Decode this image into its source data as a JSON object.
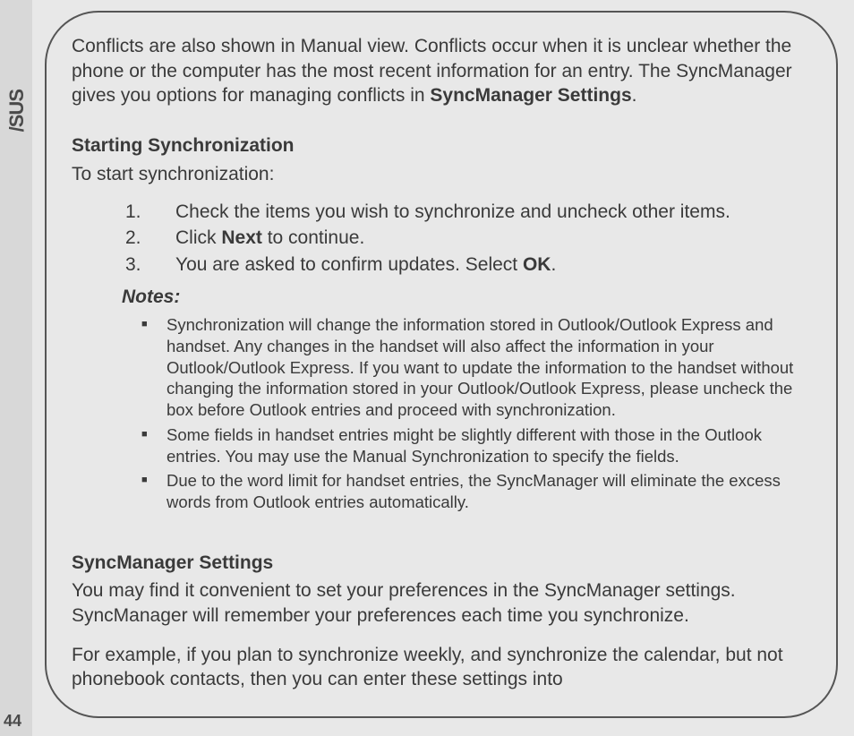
{
  "brand": "/SUS",
  "page_number": "44",
  "intro_paragraph": {
    "text_a": "Conflicts are also shown in Manual view. Conflicts occur when it is unclear whether the phone or the computer has the most recent information for an entry. The SyncManager gives you  options for managing conflicts in ",
    "bold_a": "SyncManager Settings",
    "text_b": "."
  },
  "section1": {
    "heading": "Starting Synchronization",
    "lead": "To start synchronization:",
    "steps": [
      {
        "num": "1.",
        "pre": "Check the items you wish to synchronize and uncheck other items.",
        "bold": "",
        "post": ""
      },
      {
        "num": "2.",
        "pre": "Click ",
        "bold": "Next",
        "post": " to continue."
      },
      {
        "num": "3.",
        "pre": "You are asked to confirm updates. Select ",
        "bold": "OK",
        "post": "."
      }
    ],
    "notes_label": "Notes:",
    "notes": [
      "Synchronization will change the information stored in Outlook/Outlook Express and handset. Any changes in the handset will also affect the information in your Outlook/Outlook Express. If you want to update the  information to the handset without changing the information stored in your Outlook/Outlook Express, please uncheck the box before Outlook entries and proceed with synchronization.",
      "Some fields in handset entries might be slightly different with those in the Outlook entries. You may use the Manual  Synchronization to specify the fields.",
      "Due to the word limit for handset entries, the SyncManager will eliminate the excess words from Outlook entries automatically."
    ]
  },
  "section2": {
    "heading": "SyncManager Settings",
    "para1": "You may find it convenient to set your preferences in the SyncManager settings. SyncManager will remember your preferences each time you synchronize.",
    "para2": "For example, if you  plan to synchronize weekly, and synchronize the calendar, but not phonebook contacts, then you can enter these settings into"
  }
}
